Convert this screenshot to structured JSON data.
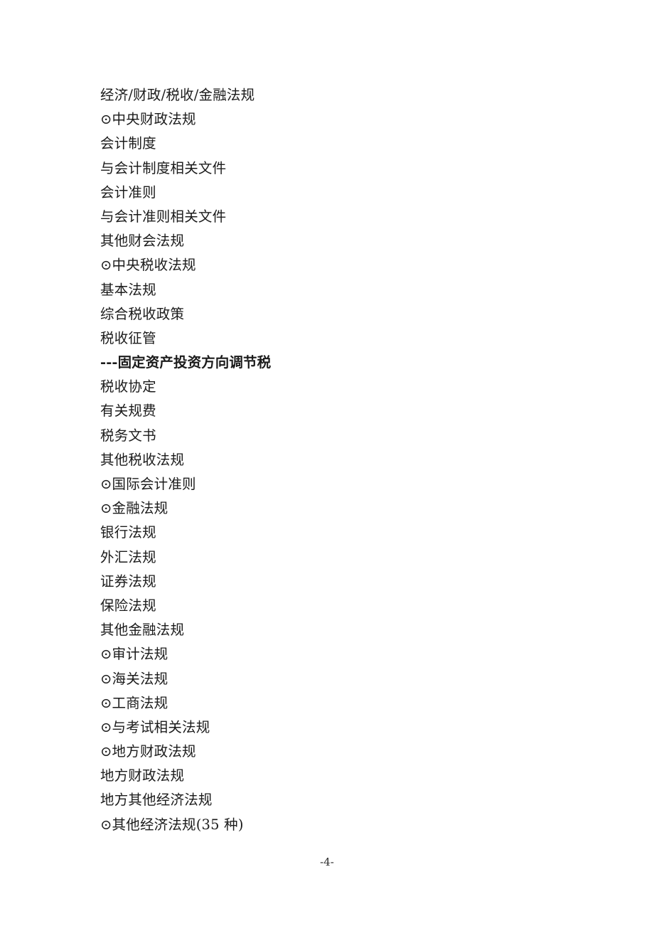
{
  "document": {
    "page_background": "#ffffff",
    "text_color": "#1b1b1b",
    "heading": "经济/财政/税收/金融法规",
    "bullet_glyph": "⊙",
    "lines": [
      {
        "text": "经济/财政/税收/金融法规",
        "level": "heading",
        "bulleted": false
      },
      {
        "text": "⊙中央财政法规",
        "level": "category",
        "bulleted": true
      },
      {
        "text": "会计制度",
        "level": "item",
        "bulleted": false
      },
      {
        "text": "与会计制度相关文件",
        "level": "item",
        "bulleted": false
      },
      {
        "text": "会计准则",
        "level": "item",
        "bulleted": false
      },
      {
        "text": "与会计准则相关文件",
        "level": "item",
        "bulleted": false
      },
      {
        "text": "其他财会法规",
        "level": "item",
        "bulleted": false
      },
      {
        "text": "⊙中央税收法规",
        "level": "category",
        "bulleted": true
      },
      {
        "text": "基本法规",
        "level": "item",
        "bulleted": false
      },
      {
        "text": "综合税收政策",
        "level": "item",
        "bulleted": false
      },
      {
        "text": "税收征管",
        "level": "item",
        "bulleted": false
      },
      {
        "text": "---固定资产投资方向调节税",
        "level": "subitem",
        "bulleted": false
      },
      {
        "text": "税收协定",
        "level": "item",
        "bulleted": false
      },
      {
        "text": "有关规费",
        "level": "item",
        "bulleted": false
      },
      {
        "text": "税务文书",
        "level": "item",
        "bulleted": false
      },
      {
        "text": "其他税收法规",
        "level": "item",
        "bulleted": false
      },
      {
        "text": "⊙国际会计准则",
        "level": "category",
        "bulleted": true
      },
      {
        "text": "⊙金融法规",
        "level": "category",
        "bulleted": true
      },
      {
        "text": "银行法规",
        "level": "item",
        "bulleted": false
      },
      {
        "text": "外汇法规",
        "level": "item",
        "bulleted": false
      },
      {
        "text": "证券法规",
        "level": "item",
        "bulleted": false
      },
      {
        "text": "保险法规",
        "level": "item",
        "bulleted": false
      },
      {
        "text": "其他金融法规",
        "level": "item",
        "bulleted": false
      },
      {
        "text": "⊙审计法规",
        "level": "category",
        "bulleted": true
      },
      {
        "text": "⊙海关法规",
        "level": "category",
        "bulleted": true
      },
      {
        "text": "⊙工商法规",
        "level": "category",
        "bulleted": true
      },
      {
        "text": "⊙与考试相关法规",
        "level": "category",
        "bulleted": true
      },
      {
        "text": "⊙地方财政法规",
        "level": "category",
        "bulleted": true
      },
      {
        "text": "地方财政法规",
        "level": "item",
        "bulleted": false
      },
      {
        "text": "地方其他经济法规",
        "level": "item",
        "bulleted": false
      },
      {
        "text": "⊙其他经济法规(35 种)",
        "level": "category",
        "bulleted": true
      }
    ],
    "footer": {
      "page_number": "-4-"
    }
  }
}
